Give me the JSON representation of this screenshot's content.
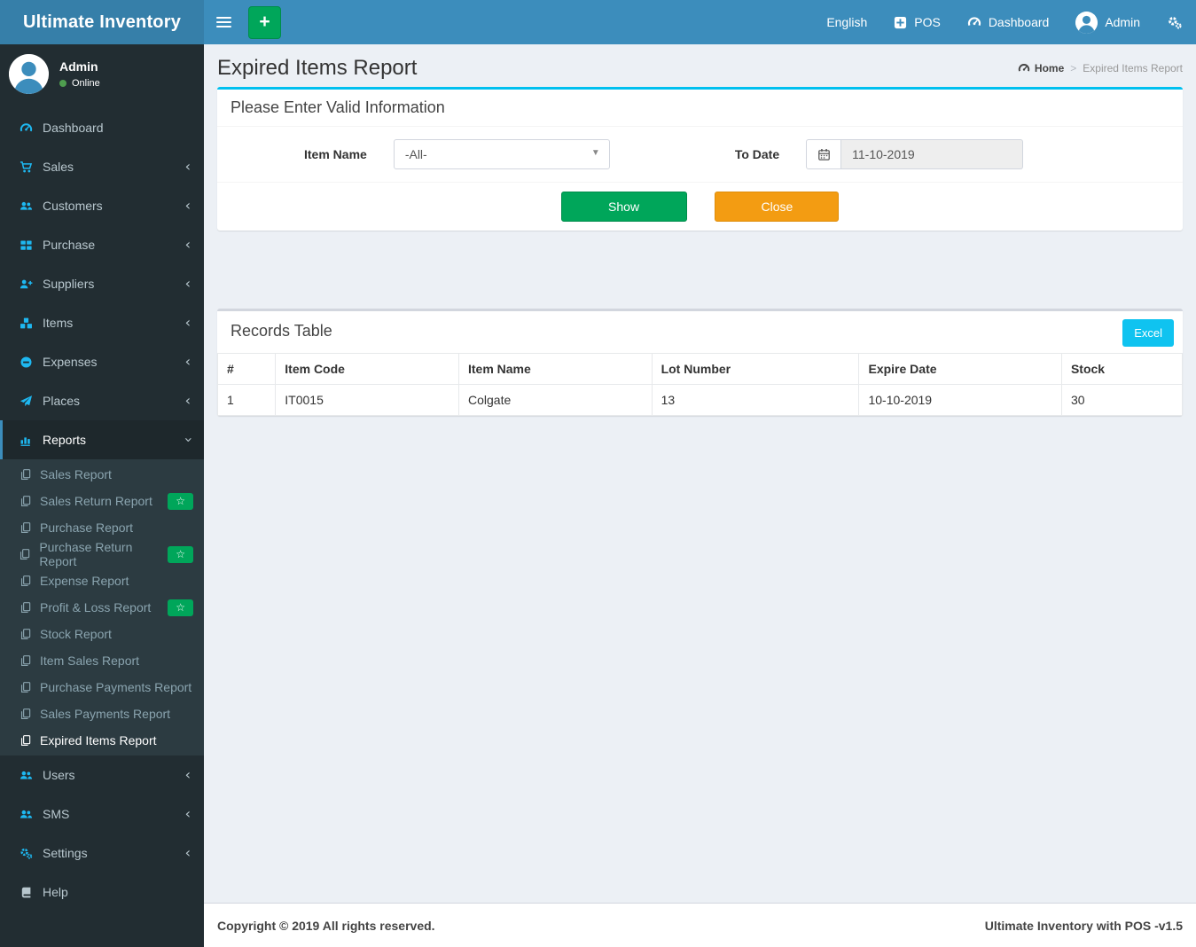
{
  "brand": {
    "title": "Ultimate Inventory"
  },
  "navbar": {
    "language_label": "English",
    "pos_label": "POS",
    "dashboard_label": "Dashboard",
    "user_label": "Admin"
  },
  "user_panel": {
    "name": "Admin",
    "status": "Online"
  },
  "sidebar": {
    "badge_star": "☆",
    "items": [
      {
        "label": "Dashboard"
      },
      {
        "label": "Sales"
      },
      {
        "label": "Customers"
      },
      {
        "label": "Purchase"
      },
      {
        "label": "Suppliers"
      },
      {
        "label": "Items"
      },
      {
        "label": "Expenses"
      },
      {
        "label": "Places"
      },
      {
        "label": "Reports"
      },
      {
        "label": "Users"
      },
      {
        "label": "SMS"
      },
      {
        "label": "Settings"
      },
      {
        "label": "Help"
      }
    ],
    "reports_submenu": [
      {
        "label": "Sales Report"
      },
      {
        "label": "Sales Return Report",
        "badge": true
      },
      {
        "label": "Purchase Report"
      },
      {
        "label": "Purchase Return Report",
        "badge": true
      },
      {
        "label": "Expense Report"
      },
      {
        "label": "Profit & Loss Report",
        "badge": true
      },
      {
        "label": "Stock Report"
      },
      {
        "label": "Item Sales Report"
      },
      {
        "label": "Purchase Payments Report"
      },
      {
        "label": "Sales Payments Report"
      },
      {
        "label": "Expired Items Report",
        "active": true
      }
    ]
  },
  "page": {
    "title": "Expired Items Report",
    "breadcrumb_home": "Home",
    "breadcrumb_separator": ">",
    "breadcrumb_current": "Expired Items Report"
  },
  "filter_panel": {
    "title": "Please Enter Valid Information",
    "item_name_label": "Item Name",
    "item_name_value": "-All-",
    "to_date_label": "To Date",
    "to_date_value": "11-10-2019",
    "show_label": "Show",
    "close_label": "Close"
  },
  "records_panel": {
    "title": "Records Table",
    "excel_label": "Excel",
    "table": {
      "headers": [
        "#",
        "Item Code",
        "Item Name",
        "Lot Number",
        "Expire Date",
        "Stock"
      ],
      "rows": [
        [
          "1",
          "IT0015",
          "Colgate",
          "13",
          "10-10-2019",
          "30"
        ]
      ]
    }
  },
  "footer": {
    "left": "Copyright © 2019 All rights reserved.",
    "right": "Ultimate Inventory with POS -v1.5"
  },
  "colors": {
    "navbar": "#3c8dbc",
    "logo_bg": "#367fa9",
    "sidebar_bg": "#222d32",
    "submenu_bg": "#2c3b41",
    "active_item_bg": "#1e282c",
    "accent_cyan": "#00c0ef",
    "sidebar_icon_blue": "#1eb8f1",
    "success_green": "#00a65a",
    "warning_orange": "#f39c12",
    "content_bg": "#ecf0f5"
  }
}
